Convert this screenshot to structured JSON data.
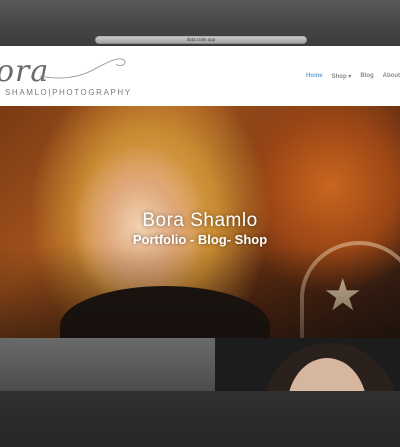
{
  "browser": {
    "url": "data:code.app"
  },
  "header": {
    "logo_script": "ora",
    "logo_subtitle": "SHAMLO|PHOTOGRAPHY"
  },
  "nav": {
    "items": [
      {
        "label": "Home",
        "active": true
      },
      {
        "label": "Shop ▾",
        "active": false
      },
      {
        "label": "Blog",
        "active": false
      },
      {
        "label": "About",
        "active": false
      }
    ]
  },
  "hero": {
    "title": "Bora Shamlo",
    "subtitle": "Portfolio - Blog- Shop"
  },
  "colors": {
    "nav_active": "#6fa4d6",
    "nav_text": "#8a8a8a"
  }
}
